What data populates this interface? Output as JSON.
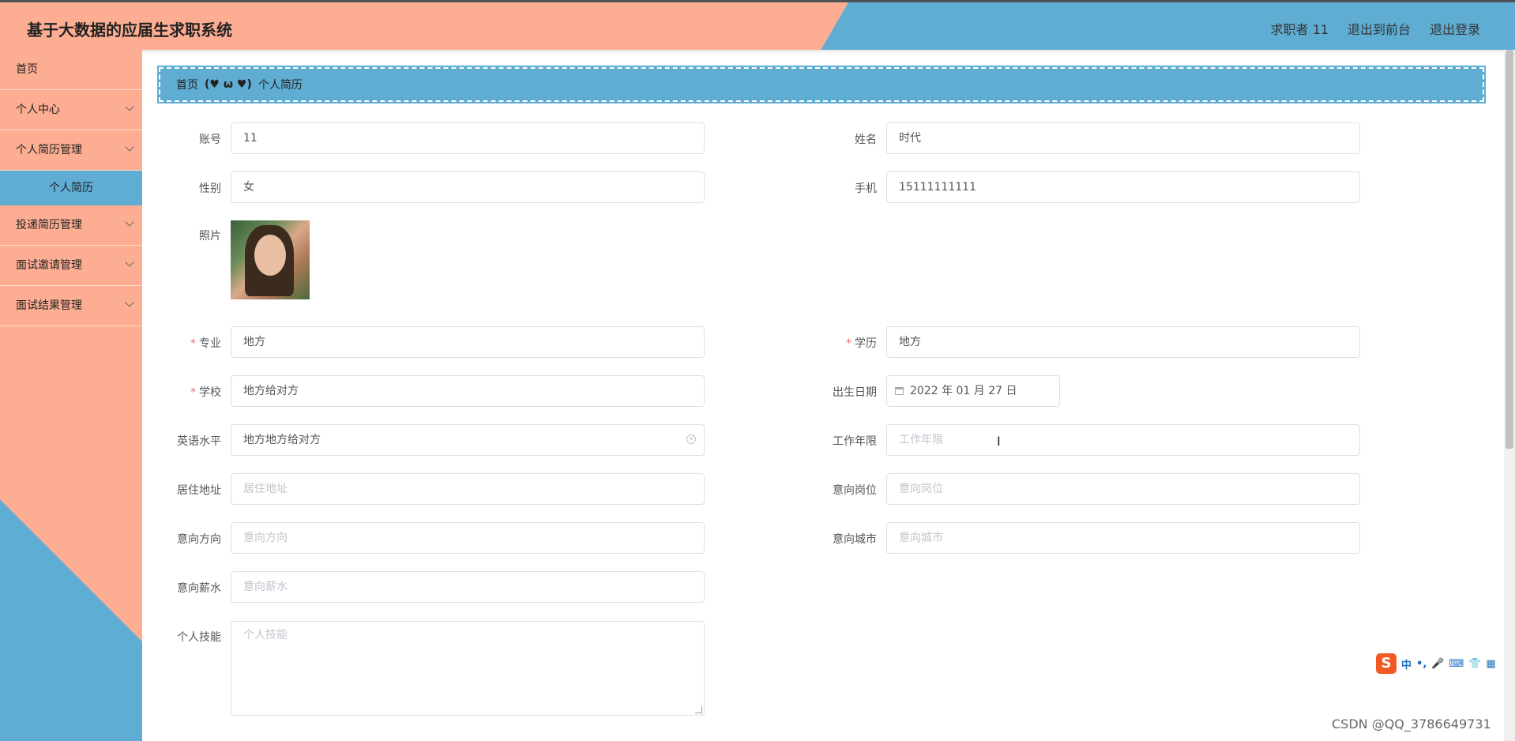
{
  "header": {
    "title": "基于大数据的应届生求职系统",
    "user": "求职者 11",
    "to_front": "退出到前台",
    "logout": "退出登录"
  },
  "sidebar": {
    "items": [
      {
        "label": "首页"
      },
      {
        "label": "个人中心"
      },
      {
        "label": "个人简历管理"
      },
      {
        "label": "个人简历"
      },
      {
        "label": "投递简历管理"
      },
      {
        "label": "面试邀请管理"
      },
      {
        "label": "面试结果管理"
      }
    ]
  },
  "breadcrumb": {
    "home": "首页",
    "separator": "(♥ ω ♥)",
    "current": "个人简历"
  },
  "form": {
    "account": {
      "label": "账号",
      "value": "11"
    },
    "name": {
      "label": "姓名",
      "value": "时代"
    },
    "gender": {
      "label": "性别",
      "value": "女"
    },
    "phone": {
      "label": "手机",
      "value": "15111111111"
    },
    "photo": {
      "label": "照片"
    },
    "major": {
      "label": "专业",
      "value": "地方"
    },
    "education": {
      "label": "学历",
      "value": "地方"
    },
    "school": {
      "label": "学校",
      "value": "地方给对方"
    },
    "birthdate": {
      "label": "出生日期",
      "value": "2022 年 01 月 27 日"
    },
    "english": {
      "label": "英语水平",
      "value": "地方地方给对方"
    },
    "work_years": {
      "label": "工作年限",
      "placeholder": "工作年限"
    },
    "address": {
      "label": "居住地址",
      "placeholder": "居住地址"
    },
    "position": {
      "label": "意向岗位",
      "placeholder": "意向岗位"
    },
    "direction": {
      "label": "意向方向",
      "placeholder": "意向方向"
    },
    "city": {
      "label": "意向城市",
      "placeholder": "意向城市"
    },
    "salary": {
      "label": "意向薪水",
      "placeholder": "意向薪水"
    },
    "skills": {
      "label": "个人技能",
      "placeholder": "个人技能"
    },
    "required_mark": "*"
  },
  "ime": {
    "logo": "S",
    "buttons": [
      "中",
      "•,",
      "🎤",
      "⌨",
      "👕",
      "▦"
    ]
  },
  "watermark": "CSDN @QQ_3786649731",
  "colors": {
    "peach": "#fdae92",
    "blue": "#5fadd3"
  }
}
